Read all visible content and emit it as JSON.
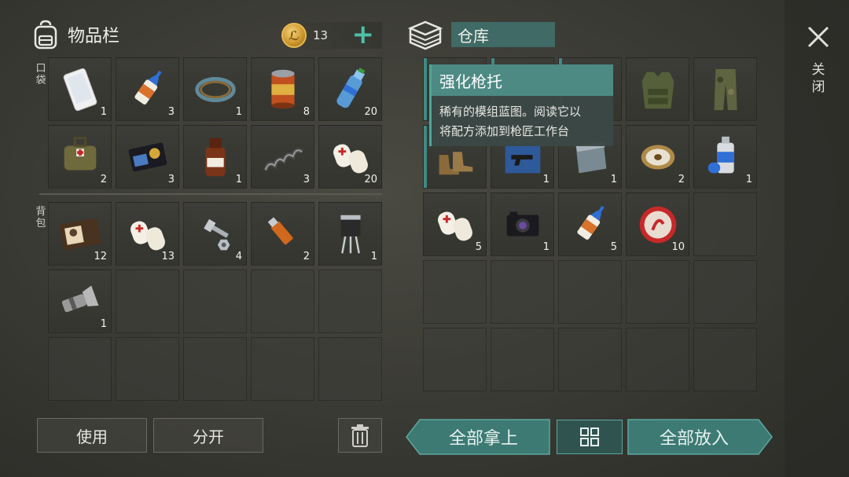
{
  "inventory": {
    "title": "物品栏",
    "coins": "13",
    "plus": "+",
    "pocket_label": "口袋",
    "backpack_label": "背包",
    "pocket_items": [
      {
        "icon": "smartphone-icon",
        "count": "1"
      },
      {
        "icon": "glue-tube-icon",
        "count": "3"
      },
      {
        "icon": "wire-coil-icon",
        "count": "1"
      },
      {
        "icon": "canned-food-icon",
        "count": "8"
      },
      {
        "icon": "water-bottle-icon",
        "count": "20"
      },
      {
        "icon": "medkit-bag-icon",
        "count": "2"
      },
      {
        "icon": "police-badge-wallet-icon",
        "count": "3"
      },
      {
        "icon": "medicine-bottle-icon",
        "count": "1"
      },
      {
        "icon": "spring-icon",
        "count": "3"
      },
      {
        "icon": "bandage-icon",
        "count": "20"
      }
    ],
    "backpack_items": [
      {
        "icon": "id-wallet-icon",
        "count": "12"
      },
      {
        "icon": "bandage-icon",
        "count": "13"
      },
      {
        "icon": "bolt-nut-icon",
        "count": "4"
      },
      {
        "icon": "usb-drive-icon",
        "count": "2"
      },
      {
        "icon": "transistor-icon",
        "count": "1"
      },
      {
        "icon": "flashlight-icon",
        "count": "1"
      }
    ]
  },
  "warehouse": {
    "title": "仓库",
    "items": [
      {
        "icon": "",
        "count": ""
      },
      {
        "icon": "",
        "count": ""
      },
      {
        "icon": "",
        "count": ""
      },
      {
        "icon": "tactical-vest-icon",
        "count": ""
      },
      {
        "icon": "camo-pants-icon",
        "count": ""
      },
      {
        "icon": "boots-icon",
        "count": ""
      },
      {
        "icon": "blueprint-icon",
        "count": "1"
      },
      {
        "icon": "metal-plate-icon",
        "count": "1"
      },
      {
        "icon": "thread-spool-icon",
        "count": "2"
      },
      {
        "icon": "spray-can-icon",
        "count": "1"
      },
      {
        "icon": "bandage-icon",
        "count": "5"
      },
      {
        "icon": "camera-icon",
        "count": "1"
      },
      {
        "icon": "glue-tube-icon",
        "count": "5"
      },
      {
        "icon": "bottle-cap-icon",
        "count": "10"
      }
    ]
  },
  "tooltip": {
    "title": "强化枪托",
    "line1": "稀有的模组蓝图。阅读它以",
    "line2": "将配方添加到枪匠工作台"
  },
  "buttons": {
    "use": "使用",
    "split": "分开",
    "take_all": "全部拿上",
    "put_all": "全部放入"
  },
  "close_label": "关闭",
  "colors": {
    "accent": "#4ec0a8",
    "teal": "#3f7a74",
    "tooltip_head": "#4d8a84"
  }
}
